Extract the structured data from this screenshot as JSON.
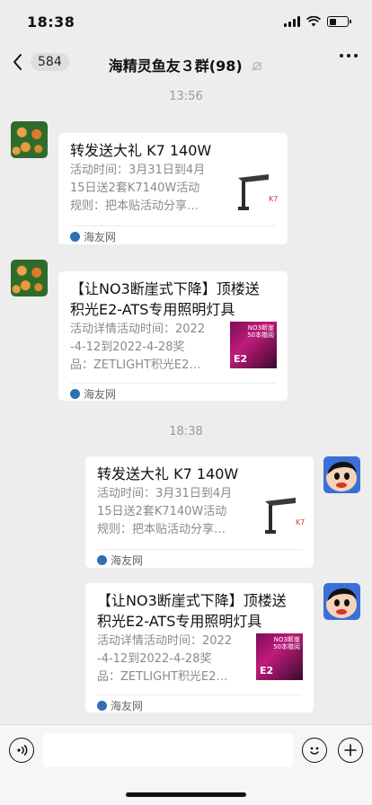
{
  "status": {
    "time": "18:38"
  },
  "nav": {
    "back_count": "584",
    "title": "海精灵鱼友３群(98)"
  },
  "timestamps": [
    "13:56",
    "18:38"
  ],
  "messages": [
    {
      "title": "转发送大礼 K7 140W",
      "desc_lines": [
        "活动时间：3月31日到4月",
        "15日送2套K7140W活动",
        "规则：把本贴活动分享…"
      ],
      "source": "海友网"
    },
    {
      "title_lines": [
        "【让NO3断崖式下降】顶楼送",
        "积光E2-ATS专用照明灯具"
      ],
      "desc_lines": [
        "活动详情活动时间：2022",
        "-4-12到2022-4-28奖",
        "品：ZETLIGHT积光E2…"
      ],
      "source": "海友网",
      "thumb_text": [
        "NO3断崖",
        "50本赠阅",
        "E2"
      ]
    },
    {
      "title": "转发送大礼 K7 140W",
      "desc_lines": [
        "活动时间：3月31日到4月",
        "15日送2套K7140W活动",
        "规则：把本贴活动分享…"
      ],
      "source": "海友网"
    },
    {
      "title_lines": [
        "【让NO3断崖式下降】顶楼送",
        "积光E2-ATS专用照明灯具"
      ],
      "desc_lines": [
        "活动详情活动时间：2022",
        "-4-12到2022-4-28奖",
        "品：ZETLIGHT积光E2…"
      ],
      "source": "海友网",
      "thumb_text": [
        "NO3断崖",
        "50本赠阅",
        "E2"
      ]
    }
  ],
  "colors": {
    "background": "#ededed",
    "card": "#ffffff",
    "muted_text": "#8a8a8a"
  }
}
